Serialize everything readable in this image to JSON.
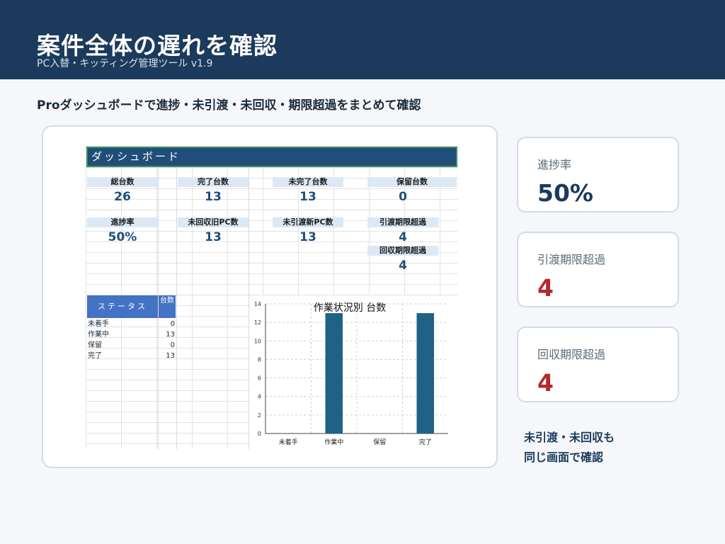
{
  "header": {
    "title": "案件全体の遅れを確認",
    "subtitle": "PC入替・キッティング管理ツール v1.9"
  },
  "lead": "Proダッシュボードで進捗・未引渡・未回収・期限超過をまとめて確認",
  "dashboard": {
    "title": "ダッシュボード",
    "kpis_row1": [
      {
        "label": "総台数",
        "value": "26"
      },
      {
        "label": "完了台数",
        "value": "13"
      },
      {
        "label": "未完了台数",
        "value": "13"
      },
      {
        "label": "保留台数",
        "value": "0"
      }
    ],
    "kpis_row2": [
      {
        "label": "進捗率",
        "value": "50%"
      },
      {
        "label": "未回収旧PC数",
        "value": "13"
      },
      {
        "label": "未引渡新PC数",
        "value": "13"
      },
      {
        "label": "引渡期限超過",
        "value": "4"
      }
    ],
    "kpi_extra": {
      "label": "回収期限超過",
      "value": "4"
    },
    "status_table": {
      "header_status": "ステータス",
      "header_count": "台数",
      "rows": [
        {
          "name": "未着手",
          "count": "0"
        },
        {
          "name": "作業中",
          "count": "13"
        },
        {
          "name": "保留",
          "count": "0"
        },
        {
          "name": "完了",
          "count": "13"
        }
      ]
    }
  },
  "chart_data": {
    "type": "bar",
    "title": "作業状況別 台数",
    "categories": [
      "未着手",
      "作業中",
      "保留",
      "完了"
    ],
    "values": [
      0,
      13,
      0,
      13
    ],
    "ylim": [
      0,
      14
    ],
    "yticks": [
      0,
      2,
      4,
      6,
      8,
      10,
      12,
      14
    ],
    "xlabel": "",
    "ylabel": "",
    "grid": true,
    "bar_color": "#1f6285"
  },
  "side_cards": [
    {
      "label": "進捗率",
      "value": "50%",
      "color": "#1b3a5c"
    },
    {
      "label": "引渡期限超過",
      "value": "4",
      "color": "#b32a2a"
    },
    {
      "label": "回収期限超過",
      "value": "4",
      "color": "#b32a2a"
    }
  ],
  "note": {
    "line1": "未引渡・未回収も",
    "line2": "同じ画面で確認"
  }
}
